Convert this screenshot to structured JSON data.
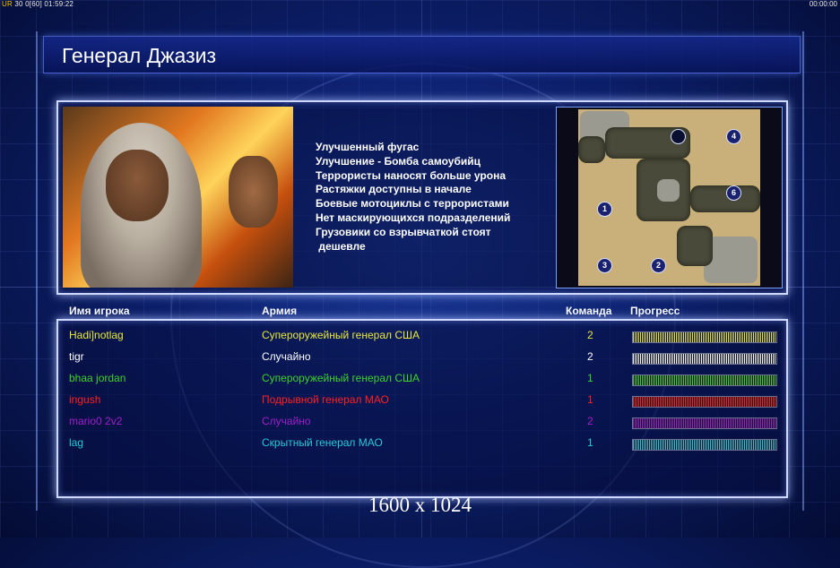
{
  "hud": {
    "left_prefix": "UR",
    "left_values": "30 0[60] 01:59:22",
    "right_time": "00:00:00"
  },
  "title": "Генерал Джазиз",
  "briefing": {
    "lines": [
      "Улучшенный фугас",
      "Улучшение - Бомба самоубийц",
      "Террористы наносят больше урона",
      "Растяжки доступны в начале",
      "Боевые мотоциклы с террористами",
      "Нет маскирующихся подразделений",
      "Грузовики со взрывчаткой стоят",
      " дешевле"
    ]
  },
  "minimap": {
    "slots": [
      "4",
      "1",
      "6",
      "3",
      "2"
    ]
  },
  "table": {
    "headers": {
      "player": "Имя игрока",
      "army": "Армия",
      "team": "Команда",
      "progress": "Прогресс"
    },
    "rows": [
      {
        "name": "Hadi]notlag",
        "army": "Супероружейный генерал США",
        "team": "2",
        "color": "#e8e83a",
        "progress": 1.0
      },
      {
        "name": "tigr",
        "army": "Случайно",
        "team": "2",
        "color": "#ffffff",
        "progress": 1.0
      },
      {
        "name": "bhaa jordan",
        "army": "Супероружейный генерал США",
        "team": "1",
        "color": "#3fd22a",
        "progress": 1.0
      },
      {
        "name": "ingush",
        "army": "Подрывной генерал МАО",
        "team": "1",
        "color": "#ff2020",
        "progress": 1.0
      },
      {
        "name": "mario0 2v2",
        "army": "Случайно",
        "team": "2",
        "color": "#a020c8",
        "progress": 1.0
      },
      {
        "name": "lag",
        "army": "Скрытный генерал МАО",
        "team": "1",
        "color": "#28c8d8",
        "progress": 1.0
      }
    ]
  },
  "resolution": "1600 x 1024"
}
